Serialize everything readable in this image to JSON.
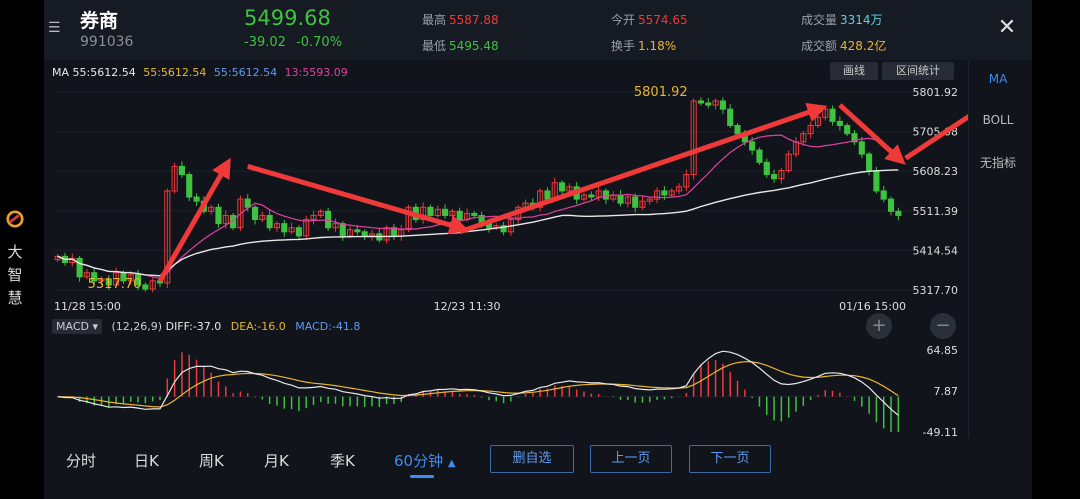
{
  "header": {
    "name": "券商",
    "code": "991036",
    "price": "5499.68",
    "change": "-39.02",
    "change_pct": "-0.70%",
    "high_label": "最高",
    "high": "5587.88",
    "low_label": "最低",
    "low": "5495.48",
    "open_label": "今开",
    "open": "5574.65",
    "turnover_label": "换手",
    "turnover": "1.18%",
    "volume_label": "成交量",
    "volume": "3314万",
    "amount_label": "成交额",
    "amount": "428.2亿",
    "close_glyph": "✕"
  },
  "ma_legend": {
    "ma": "MA 55:5612.54",
    "ma_a": "55:5612.54",
    "ma_b": "55:5612.54",
    "ma_c": "13:5593.09"
  },
  "buttons": {
    "draw": "画线",
    "range_stats": "区间统计"
  },
  "side_panel": {
    "items": [
      "MA",
      "BOLL",
      "无指标"
    ]
  },
  "left_logo": {
    "chars": [
      "大",
      "智",
      "慧"
    ]
  },
  "macd": {
    "selector": "MACD",
    "params": "(12,26,9)",
    "diff": "DIFF:-37.0",
    "dea": "DEA:-16.0",
    "macd": "MACD:-41.8"
  },
  "tabs": [
    "分时",
    "日K",
    "周K",
    "月K",
    "季K",
    "60分钟"
  ],
  "actions": {
    "remove_fav": "删自选",
    "prev": "上一页",
    "next": "下一页"
  },
  "colors": {
    "up": "#f03a3a",
    "down": "#3fc23f",
    "accent": "#3d8bf0",
    "ma_white": "#e8e8e8",
    "ma_pink": "#e040a0",
    "dea_yellow": "#e8b530",
    "annot_green": "#6fe02c"
  },
  "chart_data": [
    {
      "type": "candlestick",
      "y_ticks": [
        "5801.92",
        "5705.08",
        "5608.23",
        "5511.39",
        "5414.54",
        "5317.70"
      ],
      "ylim": [
        5317.7,
        5801.92
      ],
      "x_labels": [
        "11/28 15:00",
        "12/23 11:30",
        "01/16 15:00"
      ],
      "annotations": {
        "max_label": "5801.92",
        "min_label": "5317.70"
      },
      "close": [
        5400,
        5385,
        5395,
        5350,
        5360,
        5340,
        5345,
        5330,
        5360,
        5340,
        5355,
        5330,
        5320,
        5340,
        5335,
        5560,
        5620,
        5600,
        5545,
        5535,
        5510,
        5520,
        5480,
        5500,
        5470,
        5540,
        5520,
        5490,
        5500,
        5470,
        5480,
        5460,
        5470,
        5450,
        5490,
        5500,
        5510,
        5470,
        5480,
        5450,
        5465,
        5460,
        5450,
        5455,
        5440,
        5470,
        5450,
        5465,
        5520,
        5490,
        5520,
        5500,
        5515,
        5500,
        5510,
        5490,
        5505,
        5500,
        5480,
        5470,
        5475,
        5460,
        5490,
        5520,
        5530,
        5520,
        5560,
        5540,
        5580,
        5560,
        5570,
        5540,
        5550,
        5545,
        5560,
        5540,
        5550,
        5530,
        5545,
        5520,
        5535,
        5540,
        5560,
        5550,
        5560,
        5570,
        5600,
        5780,
        5775,
        5770,
        5780,
        5760,
        5720,
        5700,
        5680,
        5660,
        5630,
        5600,
        5590,
        5610,
        5650,
        5680,
        5700,
        5720,
        5740,
        5760,
        5730,
        5720,
        5700,
        5680,
        5650,
        5610,
        5560,
        5540,
        5510,
        5500
      ]
    },
    {
      "type": "macd",
      "y_ticks": [
        "64.85",
        "7.87",
        "-49.11"
      ],
      "ylim": [
        -49.11,
        64.85
      ],
      "diff_final": -37.0,
      "dea_final": -16.0,
      "macd_final": -41.8
    }
  ]
}
